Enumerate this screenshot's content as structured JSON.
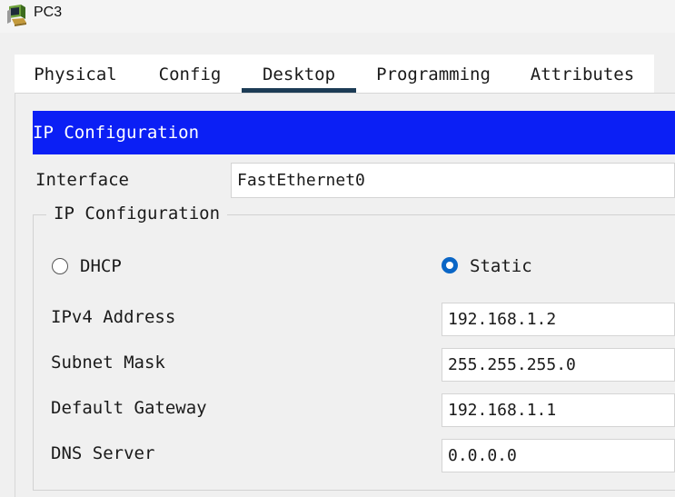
{
  "window": {
    "title": "PC3",
    "icon": "packet-tracer-pc-icon"
  },
  "tabs": [
    {
      "label": "Physical",
      "active": false
    },
    {
      "label": "Config",
      "active": false
    },
    {
      "label": "Desktop",
      "active": true
    },
    {
      "label": "Programming",
      "active": false
    },
    {
      "label": "Attributes",
      "active": false
    }
  ],
  "header": {
    "title": "IP Configuration",
    "color": "#0b1ff5"
  },
  "interface": {
    "label": "Interface",
    "value": "FastEthernet0"
  },
  "ip_config": {
    "legend": "IP Configuration",
    "mode_options": [
      {
        "label": "DHCP",
        "selected": false
      },
      {
        "label": "Static",
        "selected": true
      }
    ],
    "fields": {
      "ipv4": {
        "label": "IPv4 Address",
        "value": "192.168.1.2"
      },
      "subnet": {
        "label": "Subnet Mask",
        "value": "255.255.255.0"
      },
      "gateway": {
        "label": "Default Gateway",
        "value": "192.168.1.1"
      },
      "dns": {
        "label": "DNS Server",
        "value": "0.0.0.0"
      }
    }
  },
  "colors": {
    "active_tab_underline": "#1c3b55",
    "radio_selected": "#0a66c6"
  }
}
